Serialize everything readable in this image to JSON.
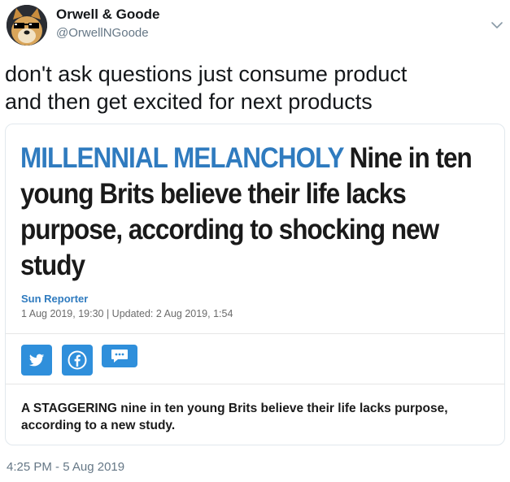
{
  "author": {
    "display_name": "Orwell & Goode",
    "handle": "@OrwellNGoode"
  },
  "tweet": {
    "text_lines": [
      "don't ask questions just consume product",
      "and then get excited for next products"
    ],
    "timestamp": "4:25 PM - 5 Aug 2019"
  },
  "card": {
    "kicker": "MILLENNIAL MELANCHOLY",
    "headline_lines": [
      "Nine in ten",
      "young Brits believe their life lacks",
      "purpose, according to shocking new",
      "study"
    ],
    "byline": "Sun Reporter",
    "dateline": "1 Aug 2019, 19:30 | Updated: 2 Aug 2019, 1:54",
    "standfirst_lines": [
      "A STAGGERING nine in ten young Brits believe their life lacks purpose,",
      "according to a new study."
    ],
    "share_icons": [
      "twitter-icon",
      "facebook-icon",
      "comment-icon"
    ],
    "accent_color": "#2f7bbf",
    "share_color": "#2f8fdb"
  },
  "icons": {
    "menu": "chevron-down-icon",
    "avatar": "doge-with-sunglasses"
  }
}
